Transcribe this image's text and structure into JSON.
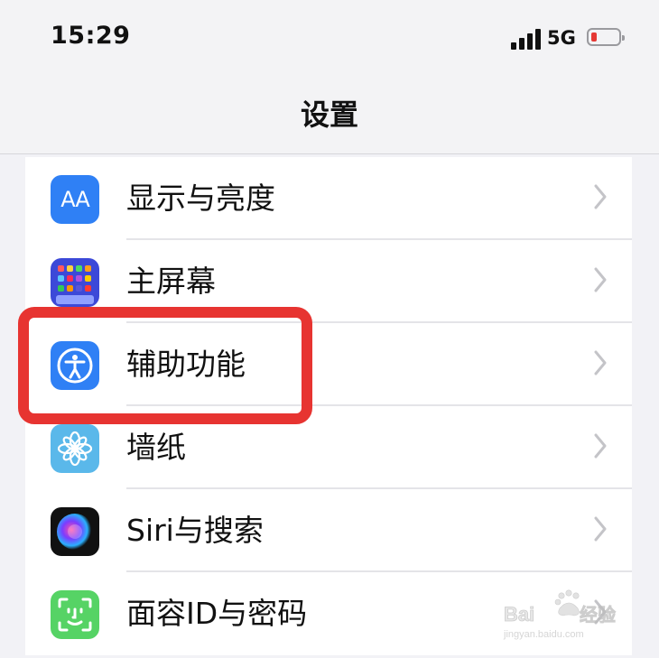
{
  "status_bar": {
    "time": "15:29",
    "network": "5G",
    "battery": "low"
  },
  "nav": {
    "title": "设置"
  },
  "settings_items": [
    {
      "label": "显示与亮度",
      "icon": "display-brightness-icon",
      "icon_text": "AA"
    },
    {
      "label": "主屏幕",
      "icon": "home-screen-icon"
    },
    {
      "label": "辅助功能",
      "icon": "accessibility-icon"
    },
    {
      "label": "墙纸",
      "icon": "wallpaper-icon"
    },
    {
      "label": "Siri与搜索",
      "icon": "siri-icon"
    },
    {
      "label": "面容ID与密码",
      "icon": "face-id-icon"
    }
  ],
  "watermark": {
    "brand": "Baidu经验",
    "url": "jingyan.baidu.com"
  },
  "colors": {
    "highlight": "#e73431",
    "accent": "#2f80f5",
    "battery_low": "#e53935"
  }
}
